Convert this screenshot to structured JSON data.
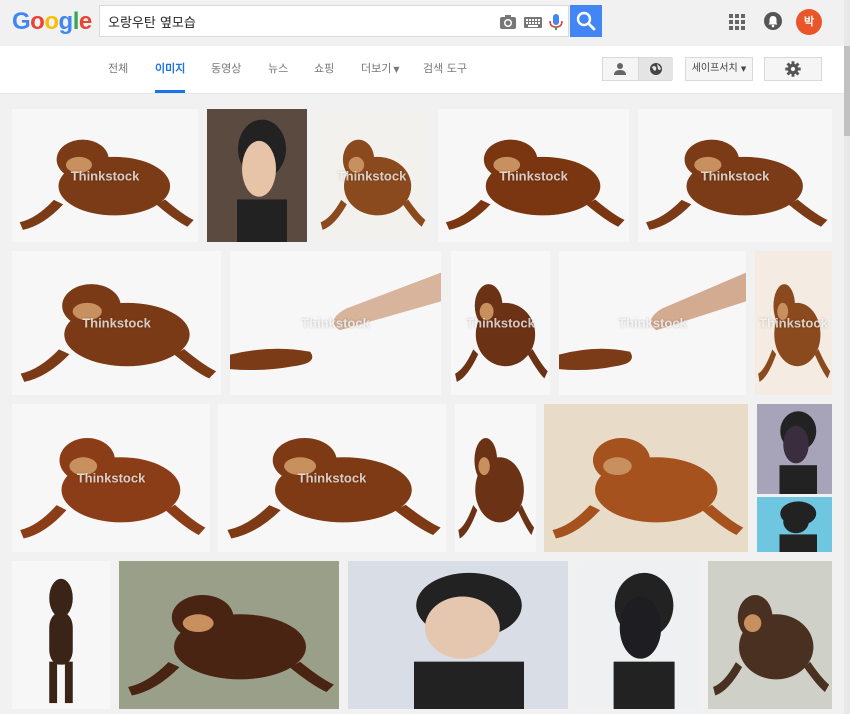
{
  "app": {
    "logo_letters": [
      {
        "ch": "G",
        "color": "#4285F4"
      },
      {
        "ch": "o",
        "color": "#EA4335"
      },
      {
        "ch": "o",
        "color": "#FBBC05"
      },
      {
        "ch": "g",
        "color": "#4285F4"
      },
      {
        "ch": "l",
        "color": "#34A853"
      },
      {
        "ch": "e",
        "color": "#EA4335"
      }
    ],
    "accent": "#4285f4"
  },
  "search": {
    "query": "오랑우탄 옆모습",
    "icons": [
      "camera-icon",
      "keyboard-icon",
      "microphone-icon",
      "search-icon"
    ]
  },
  "user": {
    "avatar_initial": "박"
  },
  "tabs": [
    {
      "label": "전체",
      "active": false
    },
    {
      "label": "이미지",
      "active": true
    },
    {
      "label": "동영상",
      "active": false
    },
    {
      "label": "뉴스",
      "active": false
    },
    {
      "label": "쇼핑",
      "active": false
    },
    {
      "label": "더보기",
      "active": false,
      "dropdown": true
    },
    {
      "label": "검색 도구",
      "active": false
    }
  ],
  "toolbar": {
    "safesearch_label": "세이프서치"
  },
  "results": [
    {
      "kind": "orangutan",
      "watermark": "Thinkstock"
    },
    {
      "kind": "woman",
      "watermark": ""
    },
    {
      "kind": "orangutan",
      "watermark": "Thinkstock"
    },
    {
      "kind": "orangutan",
      "watermark": "Thinkstock"
    },
    {
      "kind": "orangutan",
      "watermark": "Thinkstock"
    },
    {
      "kind": "orangutan",
      "watermark": "Thinkstock"
    },
    {
      "kind": "hand",
      "watermark": "Thinkstock"
    },
    {
      "kind": "orangutan",
      "watermark": "Thinkstock"
    },
    {
      "kind": "hand",
      "watermark": "Thinkstock"
    },
    {
      "kind": "orangutan",
      "watermark": "Thinkstock"
    },
    {
      "kind": "orangutan",
      "watermark": "Thinkstock"
    },
    {
      "kind": "orangutan",
      "watermark": "Thinkstock"
    },
    {
      "kind": "orangutan",
      "watermark": ""
    },
    {
      "kind": "orangutan",
      "watermark": ""
    },
    {
      "kind": "woman",
      "watermark": ""
    },
    {
      "kind": "woman",
      "watermark": ""
    },
    {
      "kind": "ape",
      "watermark": ""
    },
    {
      "kind": "orangutan",
      "watermark": ""
    },
    {
      "kind": "woman",
      "watermark": ""
    },
    {
      "kind": "woman",
      "watermark": ""
    },
    {
      "kind": "orangutan",
      "watermark": ""
    }
  ]
}
